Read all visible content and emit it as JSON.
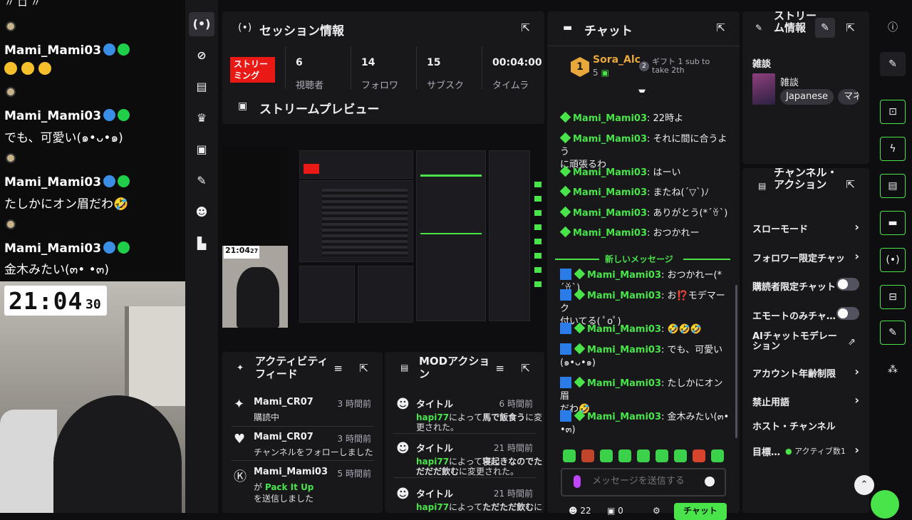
{
  "overlay": {
    "top_fragment": "〃 ロ 〃",
    "messages": [
      {
        "user": "Mami_Mami03",
        "text": "🤣🤣🤣"
      },
      {
        "user": "Mami_Mami03",
        "text": "でも、可愛い(๑•ᴗ•๑)"
      },
      {
        "user": "Mami_Mami03",
        "text": "たしかにオン眉だわ🤣"
      },
      {
        "user": "Mami_Mami03",
        "text": "金木みたい(๓• •๓)"
      }
    ],
    "clock_main": "21:04",
    "clock_seconds": "30"
  },
  "nav": {
    "icons": [
      "broadcast-icon",
      "link-icon",
      "chart-icon",
      "trophy-icon",
      "video-icon",
      "wrench-icon",
      "users-icon",
      "podium-icon"
    ]
  },
  "session": {
    "title": "セッション情報",
    "live_label": "ストリーミング",
    "stats": [
      {
        "value": "6",
        "label": "視聴者"
      },
      {
        "value": "14",
        "label": "フォロワ"
      },
      {
        "value": "15",
        "label": "サブスク"
      },
      {
        "value": "00:04:00",
        "label": "タイムラ"
      }
    ]
  },
  "preview": {
    "title": "ストリームプレビュー",
    "mini_clock": "21:04",
    "mini_clock_sec": "27"
  },
  "activity": {
    "title": "アクティビティフィード",
    "items": [
      {
        "name": "Mami_CR07",
        "time": "3 時間前",
        "desc": "購読中",
        "icon": "sparkle-icon"
      },
      {
        "name": "Mami_CR07",
        "time": "3 時間前",
        "desc": "チャンネルをフォローしました",
        "icon": "heart-icon"
      },
      {
        "name": "Mami_Mami03",
        "time": "5 時間前",
        "desc_prefix": "が",
        "desc_highlight": "Pack It Up",
        "desc2": "を送信しました",
        "icon": "kick-icon"
      }
    ]
  },
  "mod": {
    "title": "MODアクション",
    "items": [
      {
        "label": "タイトル",
        "time": "6 時間前",
        "user": "hapi77",
        "text1": "によって",
        "bold": "馬で飯食う",
        "text2": "に変",
        "line2": "更された。"
      },
      {
        "label": "タイトル",
        "time": "21 時間前",
        "user": "hapi77",
        "text1": "によって",
        "bold": "寝起きなのでた",
        "line2b": "だだだ飲む",
        "line2": "に変更された。"
      },
      {
        "label": "タイトル",
        "time": "21 時間前",
        "user": "hapi77",
        "text1": "によって",
        "bold": "ただただ飲む",
        "text2": "に",
        "line2": "変更された"
      }
    ]
  },
  "chat": {
    "title": "チャット",
    "top_gifter": {
      "rank": "1",
      "name": "Sora_Alc",
      "count": "5"
    },
    "gift_text": "ギフト 1 sub to take 2th",
    "gift_rank": "2",
    "old_messages": [
      {
        "user": "Mami_Mami03",
        "text": "22時よ"
      },
      {
        "user": "Mami_Mami03",
        "text": "それに間に合うよう",
        "text2": "に頑張るわ"
      },
      {
        "user": "Mami_Mami03",
        "text": "はーい"
      },
      {
        "user": "Mami_Mami03",
        "text": "またね(´▽`)ﾉ"
      },
      {
        "user": "Mami_Mami03",
        "text": "ありがとう(*´ꈊ`)"
      },
      {
        "user": "Mami_Mami03",
        "text": "おつかれー"
      }
    ],
    "new_label": "新しいメッセージ",
    "new_messages": [
      {
        "user": "Mami_Mami03",
        "text": "おつかれー(*´ꈊ`)"
      },
      {
        "user": "Mami_Mami03",
        "text": "お⁉️モデマーク",
        "text2": "付いてる( ﾟoﾟ)"
      },
      {
        "user": "Mami_Mami03",
        "text": "🤣🤣🤣"
      },
      {
        "user": "Mami_Mami03",
        "text": "でも、可愛い",
        "text2": "(๑•ᴗ•๑)"
      },
      {
        "user": "Mami_Mami03",
        "text": "たしかにオン眉",
        "text2": "だわ🤣"
      },
      {
        "user": "Mami_Mami03",
        "text": "金木みたい(๓•",
        "text2": "•๓)"
      }
    ],
    "input_placeholder": "メッセージを送信する",
    "send_label": "チャット",
    "footer_counts": [
      "22",
      "0"
    ]
  },
  "stream_info": {
    "title": "ストリーム情報",
    "category_heading": "雑談",
    "category": "雑談",
    "tags": [
      "Japanese",
      "マネ"
    ]
  },
  "channel_actions": {
    "title": "チャンネル・アクション",
    "rows": [
      {
        "label": "スローモード",
        "kind": "chevron"
      },
      {
        "label": "フォロワー限定チャッ",
        "kind": "chevron"
      },
      {
        "label": "購読者限定チャット",
        "kind": "toggle"
      },
      {
        "label": "エモートのみチャ…",
        "kind": "toggle"
      },
      {
        "label": "AIチャットモデレーション",
        "kind": "external"
      },
      {
        "label": "アカウント年齢制限",
        "kind": "chevron"
      },
      {
        "label": "禁止用語",
        "kind": "chevron"
      },
      {
        "label": "ホスト・チャンネル",
        "kind": "none"
      },
      {
        "label": "目標…",
        "kind": "chevron",
        "sub": "アクティブ数1"
      }
    ]
  },
  "right_toolbar": {
    "icons": [
      "info-icon",
      "pencil-icon",
      "screenshot-icon",
      "lightning-icon",
      "notes-icon",
      "chat-bubble-icon",
      "broadcast-icon",
      "layout-icon",
      "wrench-icon",
      "bubbles-icon"
    ]
  },
  "colors": {
    "accent_green": "#49e34a",
    "live_red": "#e91916",
    "panel_bg": "#18181b",
    "page_bg": "#0e0e10"
  }
}
